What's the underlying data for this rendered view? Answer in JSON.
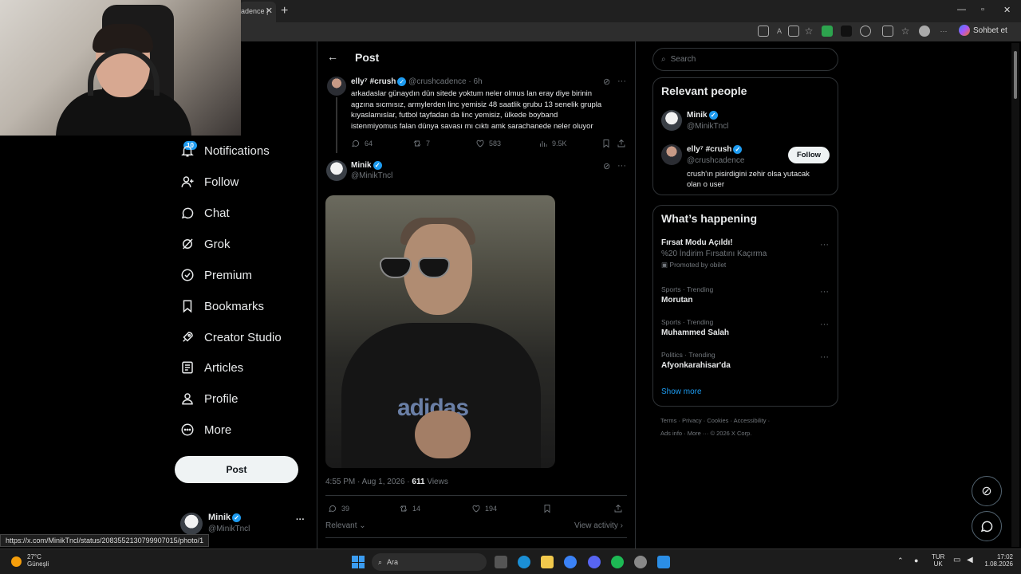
{
  "browser": {
    "tab_title": "adence |",
    "right_button": "Sohbet et",
    "status_url": "https://x.com/MinikTncl/status/2083552130799907015/photo/1"
  },
  "sidebar": {
    "items": [
      {
        "label": "Notifications",
        "icon": "bell-icon"
      },
      {
        "label": "Follow",
        "icon": "person-add-icon"
      },
      {
        "label": "Chat",
        "icon": "chat-bubble-icon"
      },
      {
        "label": "Grok",
        "icon": "grok-icon"
      },
      {
        "label": "Premium",
        "icon": "premium-badge-icon"
      },
      {
        "label": "Bookmarks",
        "icon": "bookmark-icon"
      },
      {
        "label": "Creator Studio",
        "icon": "rocket-icon"
      },
      {
        "label": "Articles",
        "icon": "article-icon"
      },
      {
        "label": "Profile",
        "icon": "person-icon"
      },
      {
        "label": "More",
        "icon": "more-circle-icon"
      }
    ],
    "notification_count": "10",
    "post_button": "Post",
    "account": {
      "name": "Minik",
      "handle": "@MinikTncl"
    }
  },
  "header": {
    "title": "Post"
  },
  "parent_tweet": {
    "name": "elly⁷ #crush",
    "handle": "@crushcadence",
    "time": "· 6h",
    "text_lines": [
      "arkadaslar günaydın dün sitede yoktum neler olmus lan eray diye birinin",
      "agzına sıcmısız, armylerden linc yemisiz 48 saatlik grubu 13 senelik grupla",
      "kıyaslamıslar, futbol tayfadan da linc yemisiz, ülkede boyband",
      "istenmiyomus falan dünya savası mı cıktı amk sarachanede neler oluyor"
    ],
    "replies": "64",
    "reposts": "7",
    "likes": "583",
    "views": "9.5K"
  },
  "main_tweet": {
    "name": "Minik",
    "handle": "@MinikTncl",
    "photo_logo": "adidas",
    "timestamp": "4:55 PM · Aug 1, 2026 · ",
    "views_count": "611",
    "views_label": " Views",
    "replies": "39",
    "reposts": "14",
    "likes": "194",
    "sort": "Relevant",
    "view_activity": "View activity ›"
  },
  "search": {
    "placeholder": "Search"
  },
  "relevant_people": {
    "title": "Relevant people",
    "people": [
      {
        "name": "Minik",
        "handle": "@MinikTncl"
      },
      {
        "name": "elly⁷ #crush",
        "handle": "@crushcadence",
        "bio_line1": "crush'ın pisirdigini zehir olsa yutacak",
        "bio_line2": "olan o user",
        "button": "Follow"
      }
    ]
  },
  "happening": {
    "title": "What’s happening",
    "promo": {
      "title": "Fırsat Modu Açıldı!",
      "subtitle": "%20 İndirim Fırsatını Kaçırma",
      "promoted": "Promoted by obilet"
    },
    "trends": [
      {
        "meta": "Sports · Trending",
        "name": "Morutan"
      },
      {
        "meta": "Sports · Trending",
        "name": "Muhammed Salah"
      },
      {
        "meta": "Politics · Trending",
        "name": "Afyonkarahisar'da"
      }
    ],
    "show_more": "Show more"
  },
  "footer": {
    "line1": "Terms · Privacy · Cookies · Accessibility ·",
    "line2": "Ads info · More ··· © 2026 X Corp."
  },
  "taskbar": {
    "temp": "27°C",
    "weather": "Güneşli",
    "search": "Ara",
    "lang1": "TUR",
    "lang2": "UK",
    "time": "17:02",
    "date": "1.08.2026"
  }
}
